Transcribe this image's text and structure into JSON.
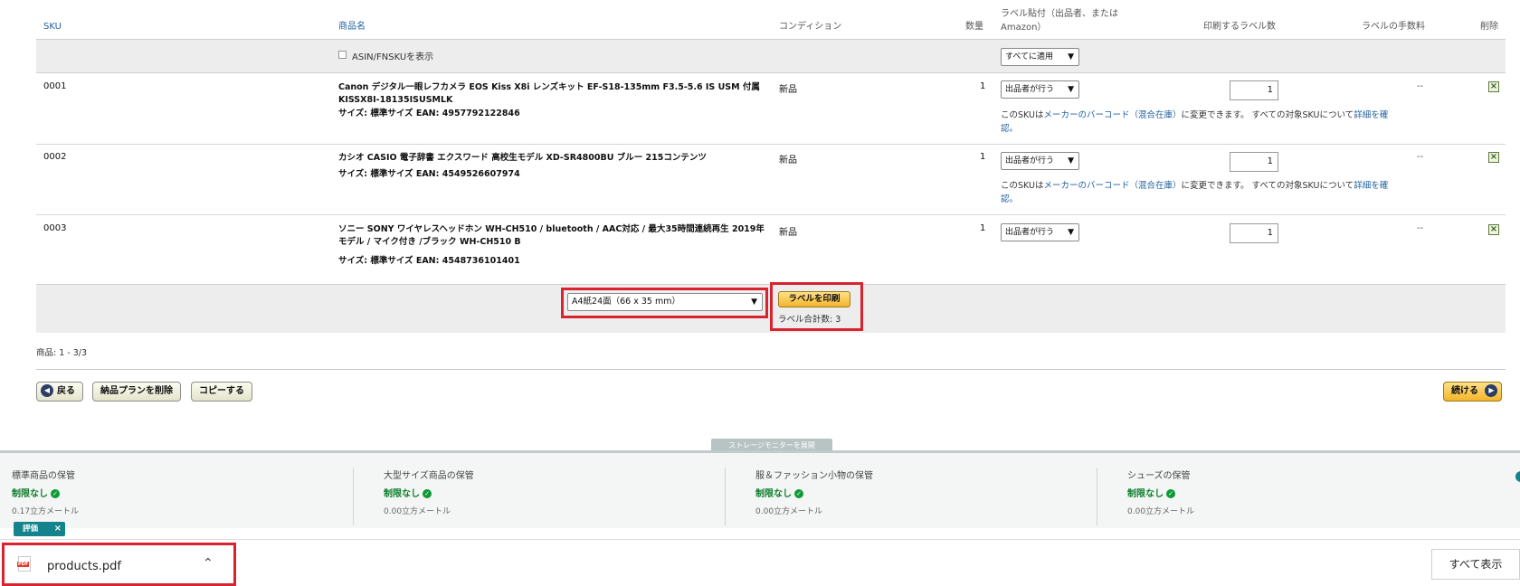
{
  "table": {
    "headers": {
      "sku": "SKU",
      "product_name": "商品名",
      "condition": "コンディション",
      "quantity": "数量",
      "label_owner_line1": "ラベル貼付（出品者、または",
      "label_owner_line2": "Amazon）",
      "labels_to_print": "印刷するラベル数",
      "label_fee": "ラベルの手数料",
      "delete": "削除"
    },
    "show_asin_label": "ASIN/FNSKUを表示",
    "apply_all": "すべてに適用",
    "rows": [
      {
        "sku": "0001",
        "title_line1": "Canon デジタル一眼レフカメラ EOS Kiss X8i レンズキット EF-S18-135mm F3.5-5.6 IS USM 付属",
        "title_line2": "KISSX8I-18135ISUSMLK",
        "meta": "サイズ: 標準サイズ EAN: 4957792122846",
        "condition": "新品",
        "quantity": "1",
        "labeler": "出品者が行う",
        "labels": "1",
        "fee": "--",
        "has_note": true
      },
      {
        "sku": "0002",
        "title_line1": "カシオ CASIO 電子辞書 エクスワード 高校生モデル XD-SR4800BU ブルー 215コンテンツ",
        "title_line2": "",
        "meta": "サイズ: 標準サイズ EAN: 4549526607974",
        "condition": "新品",
        "quantity": "1",
        "labeler": "出品者が行う",
        "labels": "1",
        "fee": "--",
        "has_note": true
      },
      {
        "sku": "0003",
        "title_line1": "ソニー SONY ワイヤレスヘッドホン WH-CH510 / bluetooth / AAC対応 / 最大35時間連続再生 2019年",
        "title_line2": "モデル / マイク付き /ブラック WH-CH510 B",
        "meta": "サイズ: 標準サイズ EAN: 4548736101401",
        "condition": "新品",
        "quantity": "1",
        "labeler": "出品者が行う",
        "labels": "1",
        "fee": "--",
        "has_note": false
      }
    ],
    "note": {
      "prefix": "このSKUは",
      "link": "メーカーのバーコード（混合在庫）",
      "middle": "に変更できます。 すべての対象SKUについて",
      "link2": "詳細を確",
      "suffix": "認。"
    }
  },
  "print": {
    "format": "A4紙24面（66 x 35 mm）",
    "print_button": "ラベルを印刷",
    "total": "ラベル合計数: 3"
  },
  "pager": "商品: 1 - 3/3",
  "actions": {
    "back": "戻る",
    "delete_plan": "納品プランを削除",
    "copy": "コピーする",
    "continue": "続ける"
  },
  "storage": {
    "toggle": "ストレージモニターを展開",
    "columns": [
      {
        "title": "標準商品の保管",
        "status": "制限なし",
        "value": "0.17立方メートル"
      },
      {
        "title": "大型サイズ商品の保管",
        "status": "制限なし",
        "value": "0.00立方メートル"
      },
      {
        "title": "服＆ファッション小物の保管",
        "status": "制限なし",
        "value": "0.00立方メートル"
      },
      {
        "title": "シューズの保管",
        "status": "制限なし",
        "value": "0.00立方メートル"
      }
    ]
  },
  "feedback_badge": "評価",
  "download": {
    "filename": "products.pdf",
    "show_all": "すべて表示"
  },
  "colors": {
    "highlight": "#d9232e",
    "link": "#1f5f9f",
    "ok_green": "#0d7d2c"
  }
}
